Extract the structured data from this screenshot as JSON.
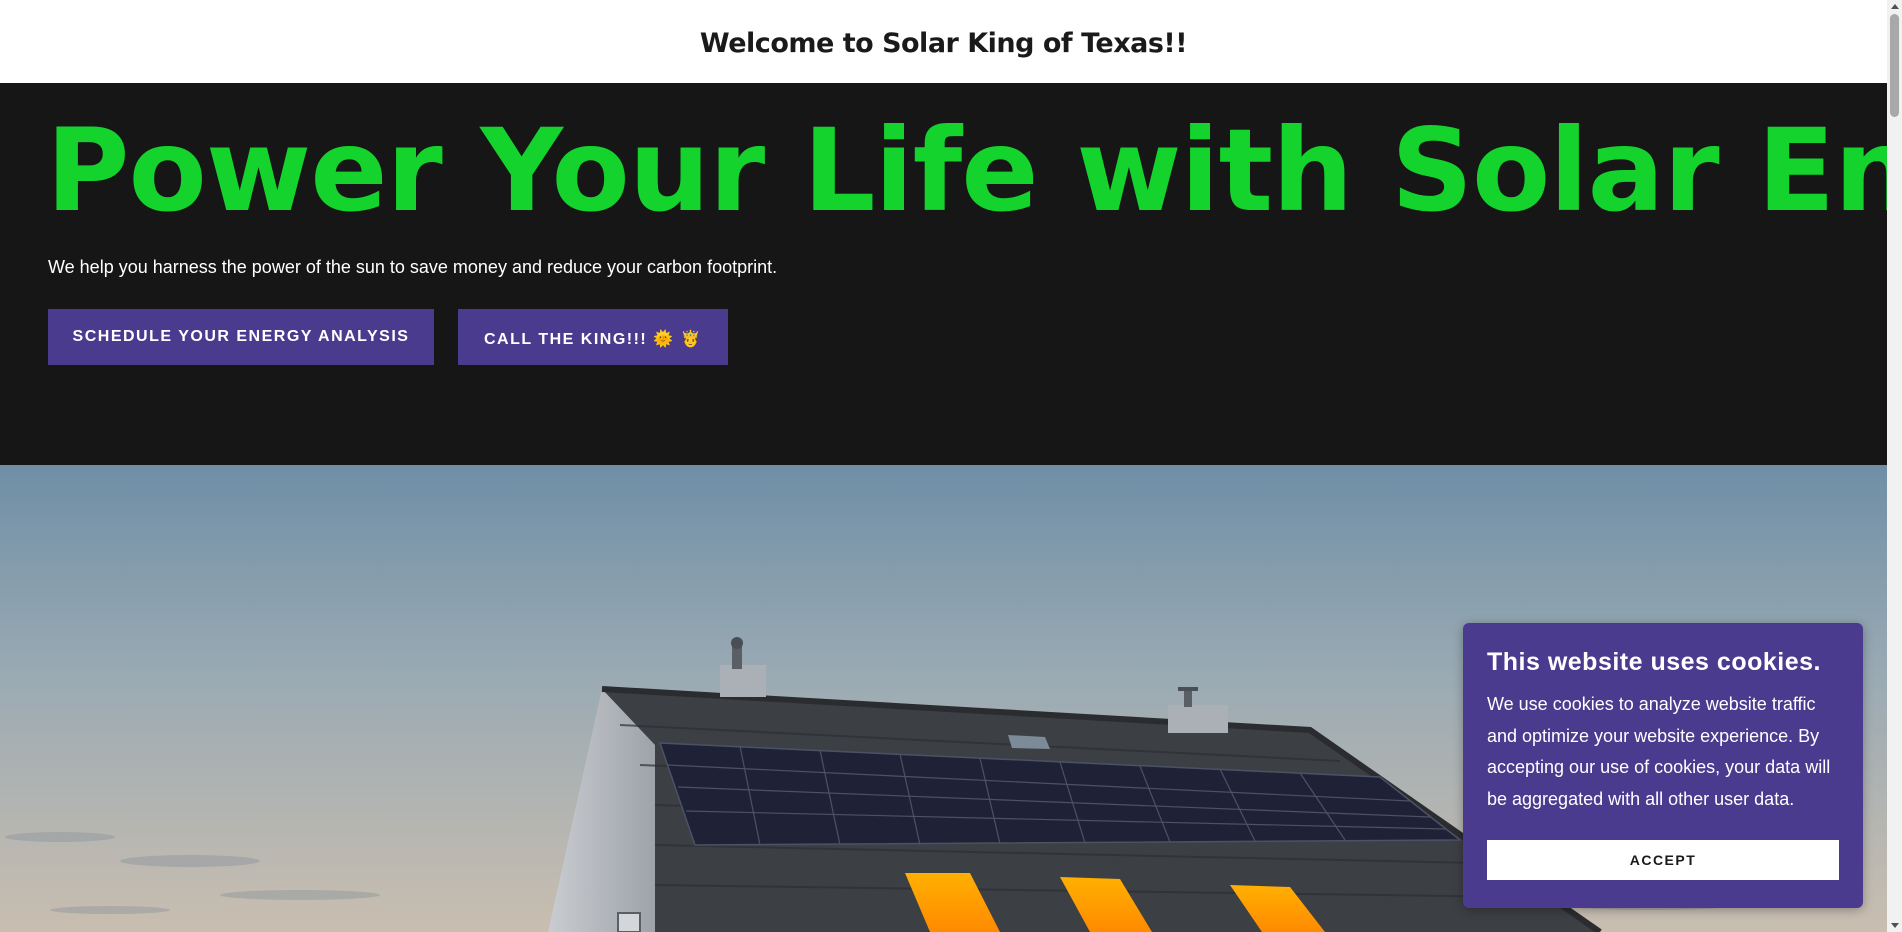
{
  "announcement": {
    "text": "Welcome to Solar King of Texas!!"
  },
  "hero": {
    "title": "Power Your Life with Solar Energy",
    "subtitle": "We help you harness the power of the sun to save money and reduce your carbon footprint.",
    "primary_button": "SCHEDULE YOUR ENERGY ANALYSIS",
    "secondary_button": "CALL THE KING!!! 🌞 🤴"
  },
  "hero_image": {
    "subject": "house-with-solar-panels"
  },
  "cookie_banner": {
    "title": "This website uses cookies.",
    "body": "We use cookies to analyze website traffic and optimize your website experience. By accepting our use of cookies, your data will be aggregated with all other user data.",
    "accept_label": "ACCEPT"
  },
  "colors": {
    "hero_background": "#161616",
    "headline_green": "#13d32c",
    "button_purple": "#4b3b8f",
    "cookie_purple": "#4b3b8f"
  }
}
